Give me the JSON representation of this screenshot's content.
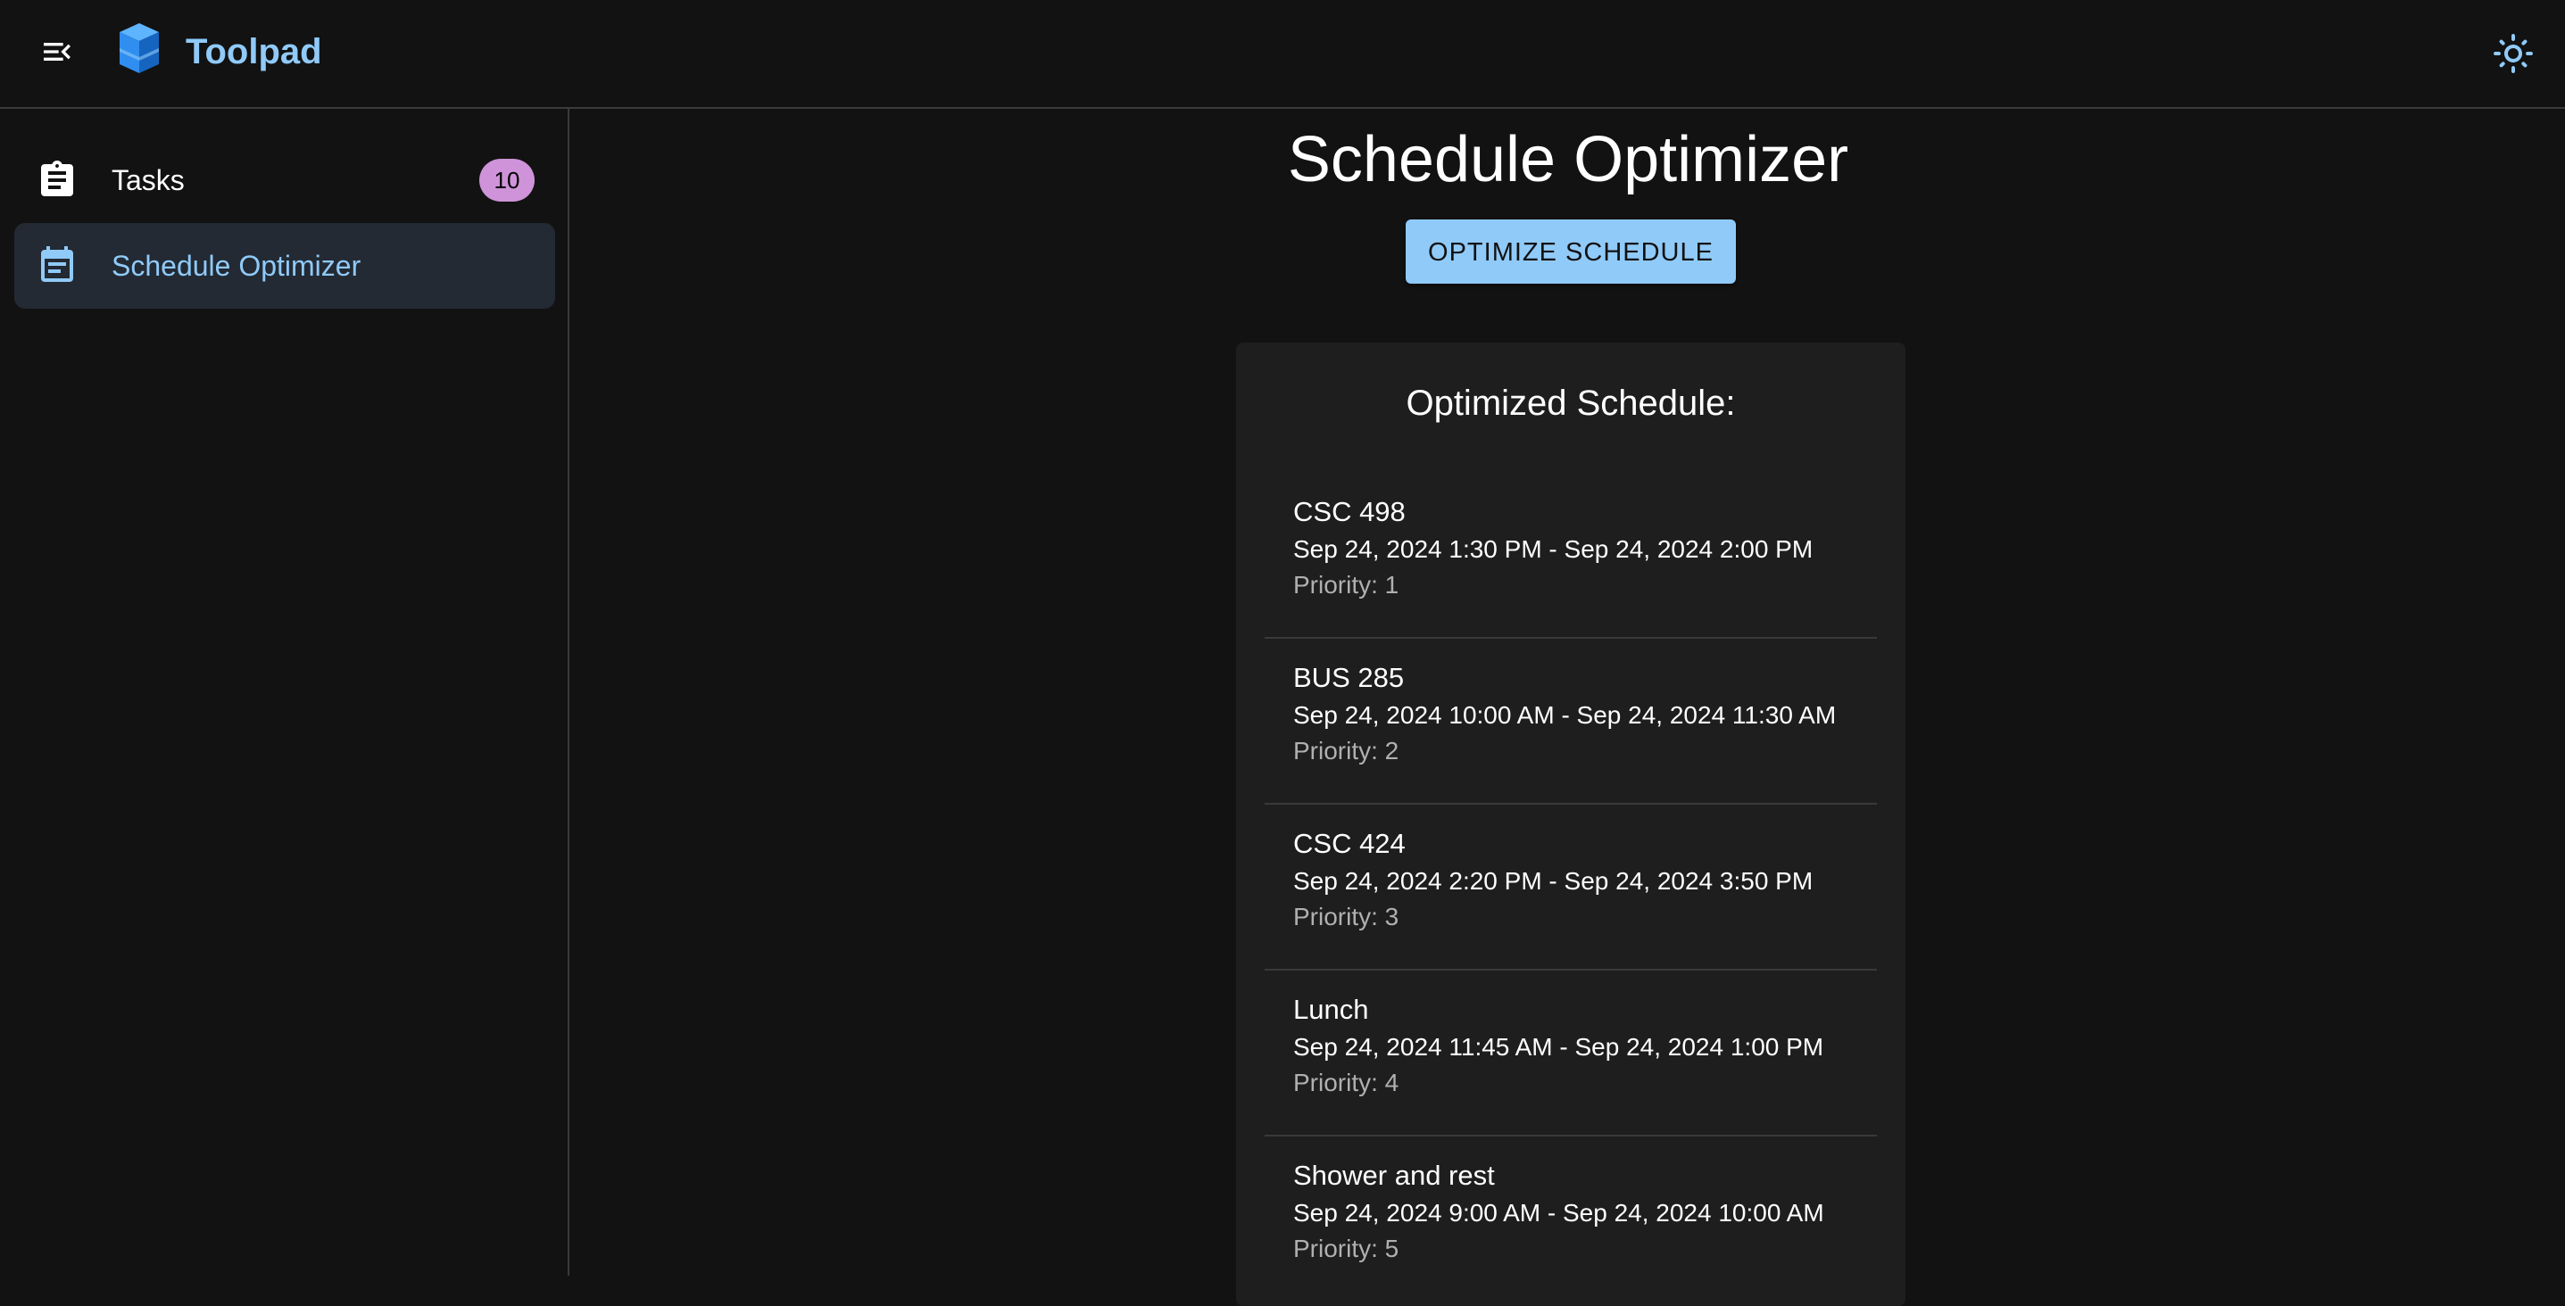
{
  "app": {
    "brand": "Toolpad",
    "icons": {
      "menu": "menu-collapse-icon",
      "logo": "cube-logo-icon",
      "theme": "sun-icon"
    },
    "colors": {
      "accent": "#90caf9",
      "badge": "#ce93d8",
      "background": "#121212",
      "card": "#1e1e1e"
    }
  },
  "sidebar": {
    "items": [
      {
        "label": "Tasks",
        "icon": "clipboard-icon",
        "badge": "10",
        "selected": false
      },
      {
        "label": "Schedule Optimizer",
        "icon": "calendar-icon",
        "selected": true
      }
    ]
  },
  "main": {
    "title": "Schedule Optimizer",
    "optimize_button": "OPTIMIZE SCHEDULE",
    "result": {
      "title": "Optimized Schedule:",
      "items": [
        {
          "name": "CSC 498",
          "time": "Sep 24, 2024 1:30 PM - Sep 24, 2024 2:00 PM",
          "priority": "Priority: 1"
        },
        {
          "name": "BUS 285",
          "time": "Sep 24, 2024 10:00 AM - Sep 24, 2024 11:30 AM",
          "priority": "Priority: 2"
        },
        {
          "name": "CSC 424",
          "time": "Sep 24, 2024 2:20 PM - Sep 24, 2024 3:50 PM",
          "priority": "Priority: 3"
        },
        {
          "name": "Lunch",
          "time": "Sep 24, 2024 11:45 AM - Sep 24, 2024 1:00 PM",
          "priority": "Priority: 4"
        },
        {
          "name": "Shower and rest",
          "time": "Sep 24, 2024 9:00 AM - Sep 24, 2024 10:00 AM",
          "priority": "Priority: 5"
        }
      ]
    }
  }
}
